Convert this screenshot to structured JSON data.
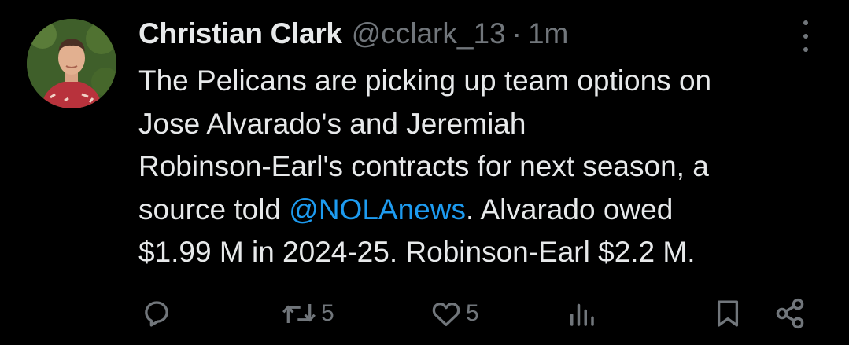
{
  "author": {
    "name": "Christian Clark",
    "handle": "@cclark_13",
    "separator": "·",
    "time": "1m"
  },
  "tweet": {
    "line1": "The Pelicans are picking up team options on",
    "line2": "Jose Alvarado's and Jeremiah",
    "line3": "Robinson-Earl's contracts for next season, a",
    "line4_before": "source told ",
    "line4_mention": "@NOLAnews",
    "line4_after": ". Alvarado owed",
    "line5": "$1.99 M in 2024-25. Robinson-Earl $2.2 M."
  },
  "actions": {
    "replies": "",
    "reposts": "5",
    "likes": "5"
  },
  "colors": {
    "background": "#000000",
    "text": "#e7e9ea",
    "muted": "#71767b",
    "link": "#1d9bf0"
  },
  "icons": [
    "reply-icon",
    "repost-icon",
    "like-icon",
    "views-icon",
    "bookmark-icon",
    "share-icon",
    "more-icon"
  ]
}
